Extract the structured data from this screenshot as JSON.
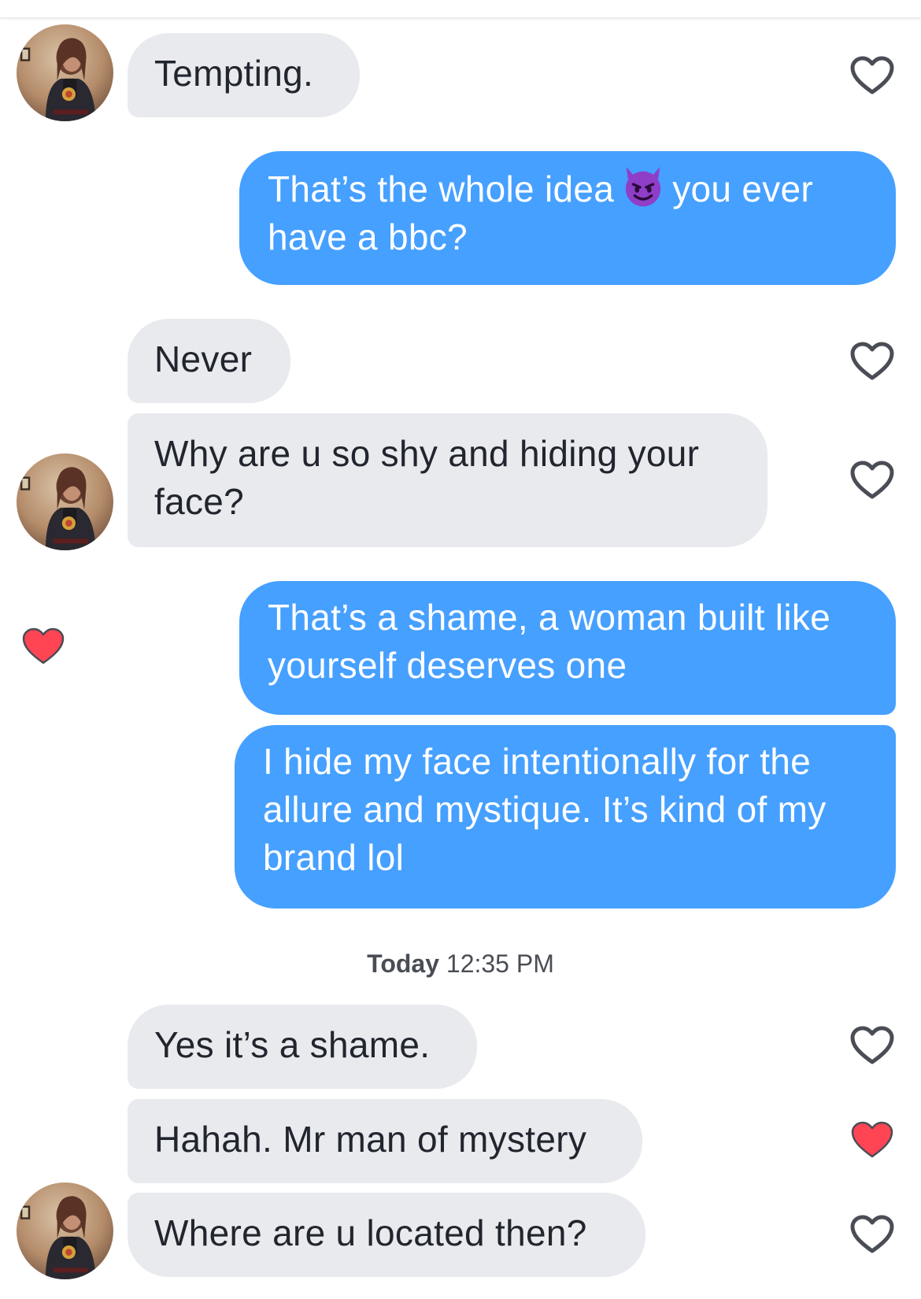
{
  "colors": {
    "incoming_bubble": "#e9eaee",
    "outgoing_bubble": "#46a0ff",
    "like_active": "#ff4454",
    "like_outline": "#4a4d55"
  },
  "messages": [
    {
      "sender": "them",
      "text": "Tempting.",
      "liked": false
    },
    {
      "sender": "me",
      "text_before": "That’s the whole idea",
      "emoji": "smiling-devil-emoji",
      "text_after": "you ever",
      "line2": "have a bbc?"
    },
    {
      "sender": "them",
      "text": "Never",
      "liked": false
    },
    {
      "sender": "them",
      "line1": "Why are u so shy and hiding your",
      "line2": "face?",
      "liked": false
    },
    {
      "sender": "me",
      "line1": "That’s a shame, a woman built like",
      "line2": "yourself deserves one",
      "liked_by_them": true
    },
    {
      "sender": "me",
      "line1": "I hide my face intentionally for the",
      "line2": "allure and mystique. It’s kind of my",
      "line3": "brand lol"
    },
    {
      "sender": "them",
      "text": "Yes it’s a shame.",
      "liked": false
    },
    {
      "sender": "them",
      "text": "Hahah. Mr man of mystery",
      "liked": true
    },
    {
      "sender": "them",
      "text": "Where are u located then?",
      "liked": false
    }
  ],
  "divider": {
    "day": "Today",
    "time": "12:35 PM"
  }
}
